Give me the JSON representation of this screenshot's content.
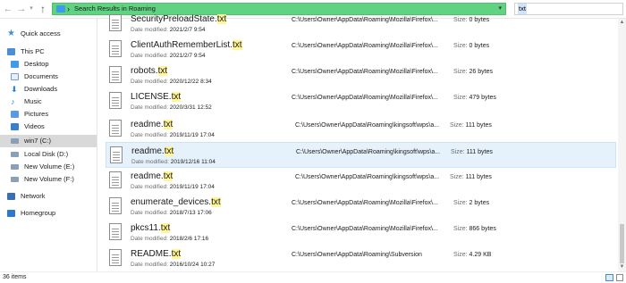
{
  "nav": {
    "back": "←",
    "forward": "→",
    "recent": "▾",
    "up": "↑"
  },
  "address": {
    "separator": "›",
    "text": "Search Results in Roaming",
    "dropdown": "▾",
    "bar_color": "#5fd37f"
  },
  "search": {
    "value": "txt"
  },
  "sidebar": {
    "items": [
      {
        "label": "Quick access",
        "icon": "star-icon"
      },
      {
        "label": "This PC",
        "icon": "computer-icon"
      },
      {
        "label": "Desktop",
        "icon": "desktop-folder-icon"
      },
      {
        "label": "Documents",
        "icon": "documents-icon"
      },
      {
        "label": "Downloads",
        "icon": "download-icon"
      },
      {
        "label": "Music",
        "icon": "music-icon"
      },
      {
        "label": "Pictures",
        "icon": "pictures-icon"
      },
      {
        "label": "Videos",
        "icon": "videos-icon"
      },
      {
        "label": "win7 (C:)",
        "icon": "drive-icon",
        "selected": true
      },
      {
        "label": "Local Disk (D:)",
        "icon": "drive-icon"
      },
      {
        "label": "New Volume (E:)",
        "icon": "drive-icon"
      },
      {
        "label": "New Volume (F:)",
        "icon": "drive-icon"
      },
      {
        "label": "Network",
        "icon": "network-icon"
      },
      {
        "label": "Homegroup",
        "icon": "homegroup-icon"
      }
    ]
  },
  "labels": {
    "date_modified": "Date modified:",
    "size": "Size:"
  },
  "files": [
    {
      "base": "SecurityPreloadState.",
      "ext": "txt",
      "date": "2021/2/7 9:54",
      "path": "C:\\Users\\Owner\\AppData\\Roaming\\Mozilla\\Firefox\\...",
      "size": "0 bytes"
    },
    {
      "base": "ClientAuthRememberList.",
      "ext": "txt",
      "date": "2021/2/7 9:54",
      "path": "C:\\Users\\Owner\\AppData\\Roaming\\Mozilla\\Firefox\\...",
      "size": "0 bytes"
    },
    {
      "base": "robots.",
      "ext": "txt",
      "date": "2020/12/22 8:34",
      "path": "C:\\Users\\Owner\\AppData\\Roaming\\Mozilla\\Firefox\\...",
      "size": "26 bytes"
    },
    {
      "base": "LICENSE.",
      "ext": "txt",
      "date": "2020/3/31 12:52",
      "path": "C:\\Users\\Owner\\AppData\\Roaming\\Mozilla\\Firefox\\...",
      "size": "479 bytes"
    },
    {
      "base": "readme.",
      "ext": "txt",
      "date": "2019/11/19 17:04",
      "path": "C:\\Users\\Owner\\AppData\\Roaming\\kingsoft\\wps\\a...",
      "size": "111 bytes"
    },
    {
      "base": "readme.",
      "ext": "txt",
      "date": "2019/12/16 11:04",
      "path": "C:\\Users\\Owner\\AppData\\Roaming\\kingsoft\\wps\\a...",
      "size": "111 bytes",
      "selected": true
    },
    {
      "base": "readme.",
      "ext": "txt",
      "date": "2019/11/19 17:04",
      "path": "C:\\Users\\Owner\\AppData\\Roaming\\kingsoft\\wps\\a...",
      "size": "111 bytes"
    },
    {
      "base": "enumerate_devices.",
      "ext": "txt",
      "date": "2018/7/13 17:06",
      "path": "C:\\Users\\Owner\\AppData\\Roaming\\Mozilla\\Firefox\\...",
      "size": "2 bytes"
    },
    {
      "base": "pkcs11.",
      "ext": "txt",
      "date": "2018/2/6 17:16",
      "path": "C:\\Users\\Owner\\AppData\\Roaming\\Mozilla\\Firefox\\...",
      "size": "866 bytes"
    },
    {
      "base": "README.",
      "ext": "txt",
      "date": "2016/10/24 10:27",
      "path": "C:\\Users\\Owner\\AppData\\Roaming\\Subversion",
      "size": "4.29 KB"
    }
  ],
  "status": {
    "count": "36 items"
  },
  "scrollbar": {
    "up": "▲",
    "down": "▼"
  }
}
